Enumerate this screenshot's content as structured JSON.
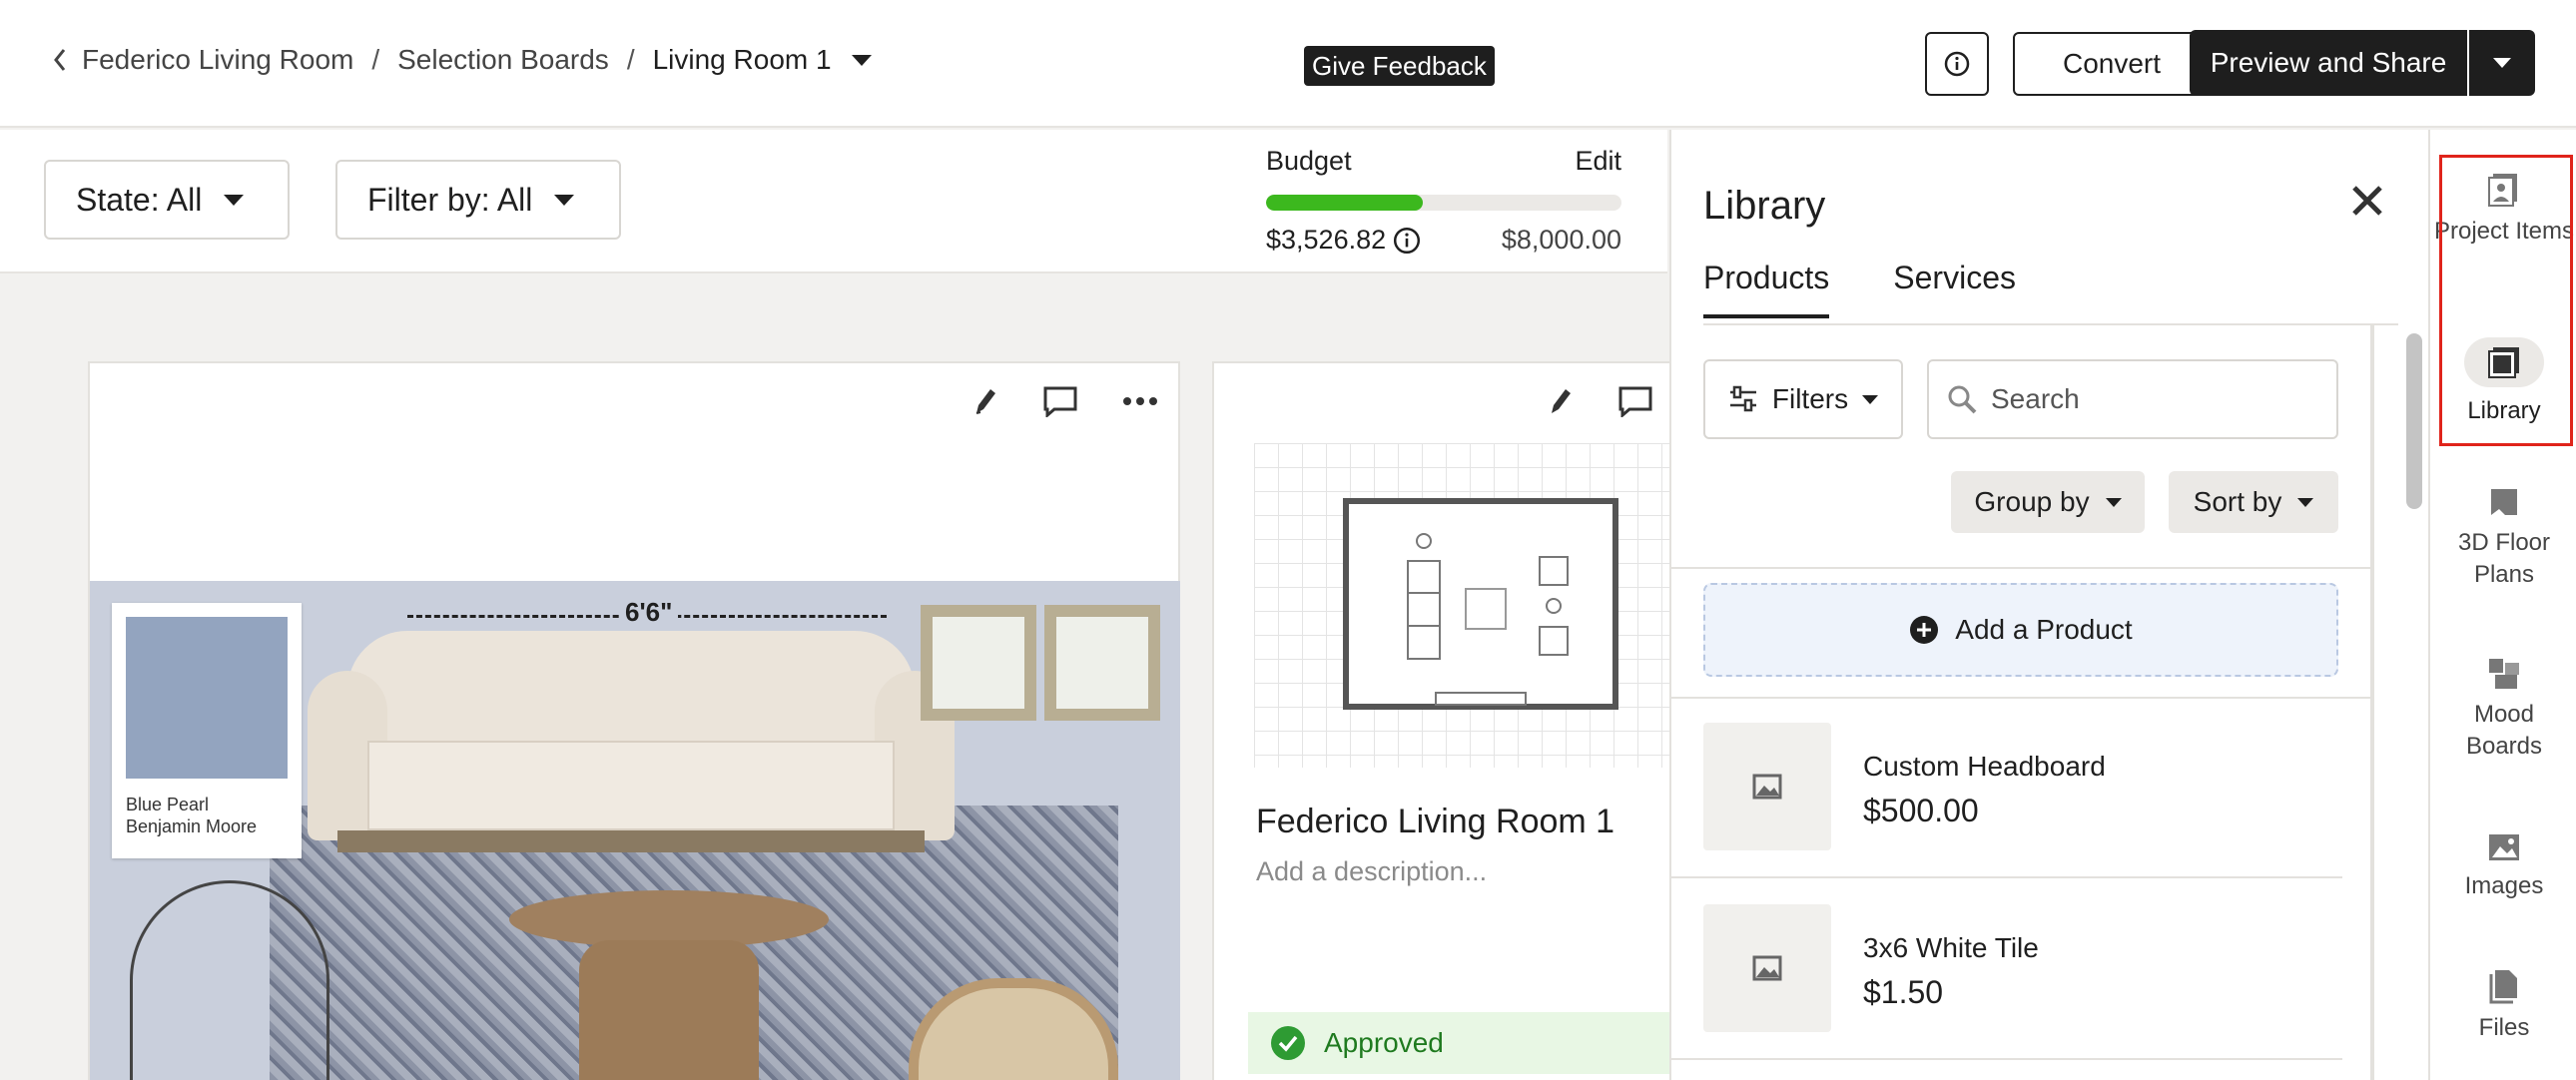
{
  "breadcrumb": {
    "items": [
      "Federico Living Room",
      "Selection Boards",
      "Living Room 1"
    ],
    "separator": "/"
  },
  "header": {
    "feedback_label": "Give Feedback",
    "convert_label": "Convert",
    "preview_label": "Preview and Share"
  },
  "filters": {
    "state_label": "State: All",
    "filter_label": "Filter by: All"
  },
  "budget": {
    "label": "Budget",
    "edit_label": "Edit",
    "spent": "$3,526.82",
    "total": "$8,000.00",
    "progress_fraction": 0.44,
    "bar_color": "#3cb81e"
  },
  "cards": [
    {
      "dimension_label": "6'6\"",
      "swatch_name": "Blue Pearl",
      "swatch_brand": "Benjamin Moore",
      "swatch_color": "#93a4bf"
    },
    {
      "title": "Federico Living Room 1",
      "description_placeholder": "Add a description...",
      "status": "Approved"
    }
  ],
  "library": {
    "title": "Library",
    "tabs": [
      "Products",
      "Services"
    ],
    "active_tab": "Products",
    "filters_label": "Filters",
    "search_placeholder": "Search",
    "group_by_label": "Group by",
    "sort_by_label": "Sort by",
    "add_product_label": "Add a Product",
    "products": [
      {
        "name": "Custom Headboard",
        "price": "$500.00"
      },
      {
        "name": "3x6 White Tile",
        "price": "$1.50"
      }
    ]
  },
  "sidebar": {
    "items": [
      {
        "label": "Project Items",
        "icon": "project-items-icon"
      },
      {
        "label": "Library",
        "icon": "library-icon"
      },
      {
        "label": "3D Floor Plans",
        "icon": "floor-plan-icon"
      },
      {
        "label": "Mood Boards",
        "icon": "mood-board-icon"
      },
      {
        "label": "Images",
        "icon": "image-icon"
      },
      {
        "label": "Files",
        "icon": "file-icon"
      }
    ],
    "highlight_color": "#e0241b"
  }
}
